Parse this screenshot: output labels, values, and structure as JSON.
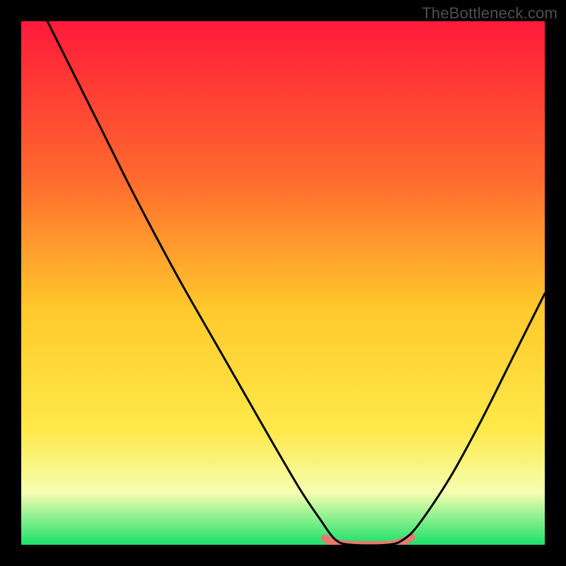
{
  "watermark": "TheBottleneck.com",
  "colors": {
    "top": "#ff1a3a",
    "upper_mid": "#ff6a2e",
    "mid": "#ffc92b",
    "lower_mid": "#ffe94a",
    "bottom_pale": "#f5ffb0",
    "bottom_green": "#1be06a",
    "line": "#000000",
    "marker": "#e77a70",
    "frame": "#000000"
  },
  "chart_data": {
    "type": "line",
    "title": "",
    "xlabel": "",
    "ylabel": "",
    "xlim": [
      0,
      100
    ],
    "ylim": [
      0,
      100
    ],
    "gradient_stops": [
      {
        "offset": 0,
        "color": "#ff1a3a"
      },
      {
        "offset": 30,
        "color": "#ff6a2e"
      },
      {
        "offset": 55,
        "color": "#ffc92b"
      },
      {
        "offset": 78,
        "color": "#ffe94a"
      },
      {
        "offset": 90,
        "color": "#f5ffb0"
      },
      {
        "offset": 100,
        "color": "#1be06a"
      }
    ],
    "series": [
      {
        "name": "bottleneck-curve",
        "points": [
          {
            "x": 5,
            "y": 100
          },
          {
            "x": 9,
            "y": 92
          },
          {
            "x": 15,
            "y": 80
          },
          {
            "x": 22,
            "y": 66
          },
          {
            "x": 30,
            "y": 51
          },
          {
            "x": 38,
            "y": 37
          },
          {
            "x": 46,
            "y": 23
          },
          {
            "x": 53,
            "y": 11
          },
          {
            "x": 57,
            "y": 5
          },
          {
            "x": 60,
            "y": 1
          },
          {
            "x": 63,
            "y": 0
          },
          {
            "x": 70,
            "y": 0
          },
          {
            "x": 73,
            "y": 1
          },
          {
            "x": 76,
            "y": 4
          },
          {
            "x": 82,
            "y": 13
          },
          {
            "x": 88,
            "y": 24
          },
          {
            "x": 94,
            "y": 36
          },
          {
            "x": 100,
            "y": 48
          }
        ]
      }
    ],
    "optimal_marker": {
      "points": [
        {
          "x": 58,
          "y": 1.2
        },
        {
          "x": 60,
          "y": 0.4
        },
        {
          "x": 63,
          "y": 0
        },
        {
          "x": 70,
          "y": 0
        },
        {
          "x": 72.5,
          "y": 0.5
        },
        {
          "x": 74.5,
          "y": 1.4
        }
      ]
    }
  }
}
